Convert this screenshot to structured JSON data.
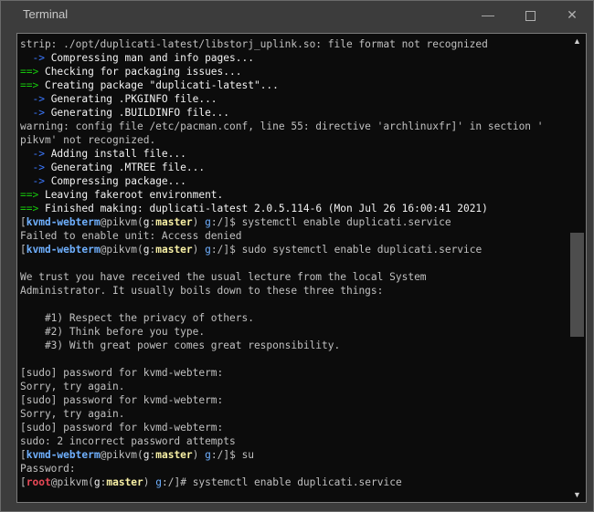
{
  "window": {
    "title": "Terminal",
    "min_glyph": "—",
    "close_glyph": "✕"
  },
  "terminal": {
    "lines": [
      [
        {
          "t": "strip: ./opt/duplicati-latest/libstorj_uplink.so: file format not recognized",
          "c": ""
        }
      ],
      [
        {
          "t": "  -> ",
          "c": "c-blue"
        },
        {
          "t": "Compressing man and info pages...",
          "c": "c-white"
        }
      ],
      [
        {
          "t": "==> ",
          "c": "c-green"
        },
        {
          "t": "Checking for packaging issues...",
          "c": "c-white"
        }
      ],
      [
        {
          "t": "==> ",
          "c": "c-green"
        },
        {
          "t": "Creating package \"duplicati-latest\"...",
          "c": "c-white"
        }
      ],
      [
        {
          "t": "  -> ",
          "c": "c-blue"
        },
        {
          "t": "Generating .PKGINFO file...",
          "c": "c-white"
        }
      ],
      [
        {
          "t": "  -> ",
          "c": "c-blue"
        },
        {
          "t": "Generating .BUILDINFO file...",
          "c": "c-white"
        }
      ],
      [
        {
          "t": "warning: config file /etc/pacman.conf, line 55: directive 'archlinuxfr]' in section '",
          "c": ""
        }
      ],
      [
        {
          "t": "pikvm' not recognized.",
          "c": ""
        }
      ],
      [
        {
          "t": "  -> ",
          "c": "c-blue"
        },
        {
          "t": "Adding install file...",
          "c": "c-white"
        }
      ],
      [
        {
          "t": "  -> ",
          "c": "c-blue"
        },
        {
          "t": "Generating .MTREE file...",
          "c": "c-white"
        }
      ],
      [
        {
          "t": "  -> ",
          "c": "c-blue"
        },
        {
          "t": "Compressing package...",
          "c": "c-white"
        }
      ],
      [
        {
          "t": "==> ",
          "c": "c-green"
        },
        {
          "t": "Leaving fakeroot environment.",
          "c": "c-white"
        }
      ],
      [
        {
          "t": "==> ",
          "c": "c-green"
        },
        {
          "t": "Finished making: duplicati-latest 2.0.5.114-6 (Mon Jul 26 16:00:41 2021)",
          "c": "c-white"
        }
      ],
      [
        {
          "t": "[",
          "c": ""
        },
        {
          "t": "kvmd-webterm",
          "c": "c-lblue bold"
        },
        {
          "t": "@pikvm(",
          "c": ""
        },
        {
          "t": "g",
          "c": "c-white"
        },
        {
          "t": ":",
          "c": ""
        },
        {
          "t": "master",
          "c": "c-yellow bold"
        },
        {
          "t": ") ",
          "c": ""
        },
        {
          "t": "g",
          "c": "c-lblue"
        },
        {
          "t": ":/]$ systemctl enable duplicati.service",
          "c": ""
        }
      ],
      [
        {
          "t": "Failed to enable unit: Access denied",
          "c": ""
        }
      ],
      [
        {
          "t": "[",
          "c": ""
        },
        {
          "t": "kvmd-webterm",
          "c": "c-lblue bold"
        },
        {
          "t": "@pikvm(",
          "c": ""
        },
        {
          "t": "g",
          "c": "c-white"
        },
        {
          "t": ":",
          "c": ""
        },
        {
          "t": "master",
          "c": "c-yellow bold"
        },
        {
          "t": ") ",
          "c": ""
        },
        {
          "t": "g",
          "c": "c-lblue"
        },
        {
          "t": ":/]$ sudo systemctl enable duplicati.service",
          "c": ""
        }
      ],
      [
        {
          "t": "",
          "c": ""
        }
      ],
      [
        {
          "t": "We trust you have received the usual lecture from the local System",
          "c": ""
        }
      ],
      [
        {
          "t": "Administrator. It usually boils down to these three things:",
          "c": ""
        }
      ],
      [
        {
          "t": "",
          "c": ""
        }
      ],
      [
        {
          "t": "    #1) Respect the privacy of others.",
          "c": ""
        }
      ],
      [
        {
          "t": "    #2) Think before you type.",
          "c": ""
        }
      ],
      [
        {
          "t": "    #3) With great power comes great responsibility.",
          "c": ""
        }
      ],
      [
        {
          "t": "",
          "c": ""
        }
      ],
      [
        {
          "t": "[sudo] password for kvmd-webterm:",
          "c": ""
        }
      ],
      [
        {
          "t": "Sorry, try again.",
          "c": ""
        }
      ],
      [
        {
          "t": "[sudo] password for kvmd-webterm:",
          "c": ""
        }
      ],
      [
        {
          "t": "Sorry, try again.",
          "c": ""
        }
      ],
      [
        {
          "t": "[sudo] password for kvmd-webterm:",
          "c": ""
        }
      ],
      [
        {
          "t": "sudo: 2 incorrect password attempts",
          "c": ""
        }
      ],
      [
        {
          "t": "[",
          "c": ""
        },
        {
          "t": "kvmd-webterm",
          "c": "c-lblue bold"
        },
        {
          "t": "@pikvm(",
          "c": ""
        },
        {
          "t": "g",
          "c": "c-white"
        },
        {
          "t": ":",
          "c": ""
        },
        {
          "t": "master",
          "c": "c-yellow bold"
        },
        {
          "t": ") ",
          "c": ""
        },
        {
          "t": "g",
          "c": "c-lblue"
        },
        {
          "t": ":/]$ su",
          "c": ""
        }
      ],
      [
        {
          "t": "Password:",
          "c": ""
        }
      ],
      [
        {
          "t": "[",
          "c": ""
        },
        {
          "t": "root",
          "c": "c-red bold"
        },
        {
          "t": "@pikvm(",
          "c": ""
        },
        {
          "t": "g",
          "c": "c-white"
        },
        {
          "t": ":",
          "c": ""
        },
        {
          "t": "master",
          "c": "c-yellow bold"
        },
        {
          "t": ") ",
          "c": ""
        },
        {
          "t": "g",
          "c": "c-lblue"
        },
        {
          "t": ":/]# systemctl enable duplicati.service",
          "c": ""
        }
      ]
    ]
  },
  "scrollbar": {
    "up_glyph": "▲",
    "down_glyph": "▼",
    "position_fraction": 0.55
  }
}
